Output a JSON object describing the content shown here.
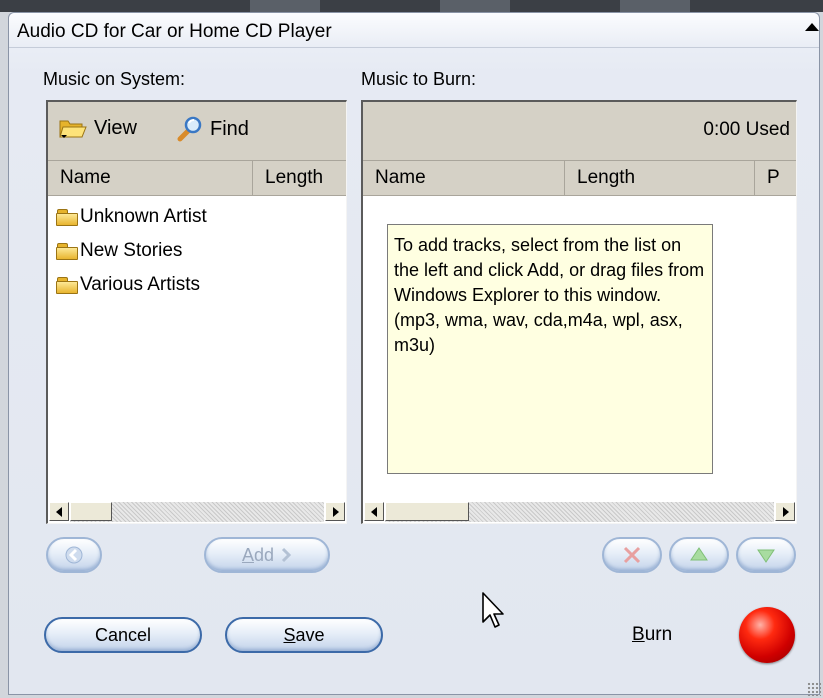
{
  "window": {
    "title": "Audio CD for Car or Home CD Player"
  },
  "left_panel": {
    "heading": "Music on System:",
    "toolbar": {
      "view_label": "View",
      "find_label": "Find"
    },
    "columns": [
      "Name",
      "Length"
    ],
    "items": [
      {
        "label": "Unknown Artist",
        "icon": "folder-icon"
      },
      {
        "label": "New Stories",
        "icon": "folder-icon"
      },
      {
        "label": "Various Artists",
        "icon": "folder-icon"
      }
    ]
  },
  "right_panel": {
    "heading": "Music to Burn:",
    "used_label": "0:00 Used",
    "columns": [
      "Name",
      "Length",
      "P"
    ],
    "hint": "To add tracks, select from the list on the left and click Add, or drag files from Windows Explorer to this window. (mp3, wma, wav, cda,m4a, wpl, asx, m3u)"
  },
  "buttons": {
    "back_icon": "arrow-left-icon",
    "add_label_mnemonic": "A",
    "add_label_rest": "dd",
    "remove_icon": "remove-x-icon",
    "move_up_icon": "arrow-up-icon",
    "move_down_icon": "arrow-down-icon",
    "cancel_label": "Cancel",
    "save_label_mnemonic": "S",
    "save_label_rest": "ave",
    "burn_label_mnemonic": "B",
    "burn_label_rest": "urn"
  },
  "colors": {
    "accent": "#3c6aa8",
    "burn_red": "#e01400",
    "hint_bg": "#ffffe1",
    "header_bg": "#d5d1c6"
  }
}
